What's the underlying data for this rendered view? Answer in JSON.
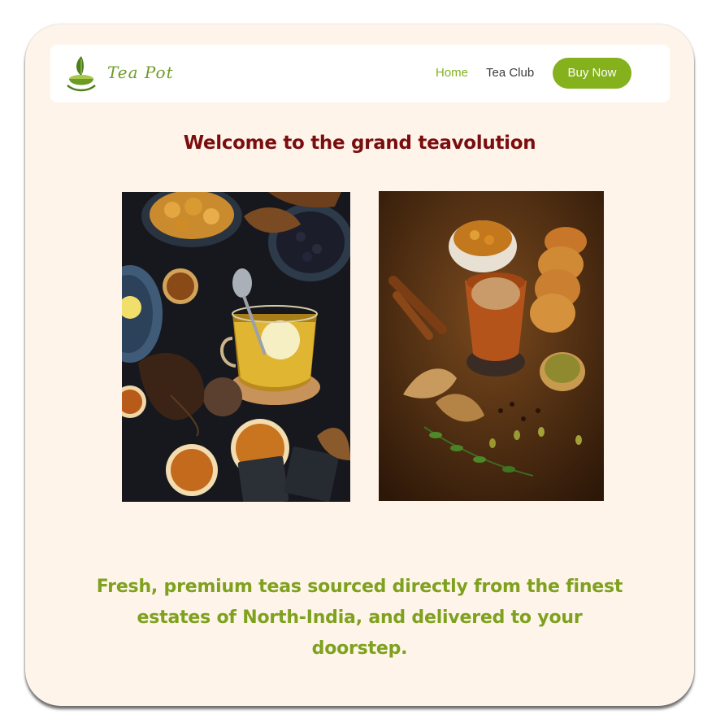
{
  "brand": {
    "name": "Tea Pot",
    "logo_icon": "teacup-leaf-icon"
  },
  "nav": {
    "items": [
      {
        "label": "Home",
        "active": true
      },
      {
        "label": "Tea Club",
        "active": false
      }
    ],
    "cta_label": "Buy Now"
  },
  "hero": {
    "headline": "Welcome to the grand teavolution",
    "images": [
      {
        "name": "lemon-tea-photo"
      },
      {
        "name": "masala-chai-photo"
      }
    ]
  },
  "tagline": "Fresh, premium teas sourced directly from the finest estates of North-India, and delivered to your doorstep.",
  "colors": {
    "card_bg": "#fff4ea",
    "accent_green": "#84b11c",
    "headline_red": "#7a0e0e",
    "tagline_green": "#7ea11e"
  }
}
